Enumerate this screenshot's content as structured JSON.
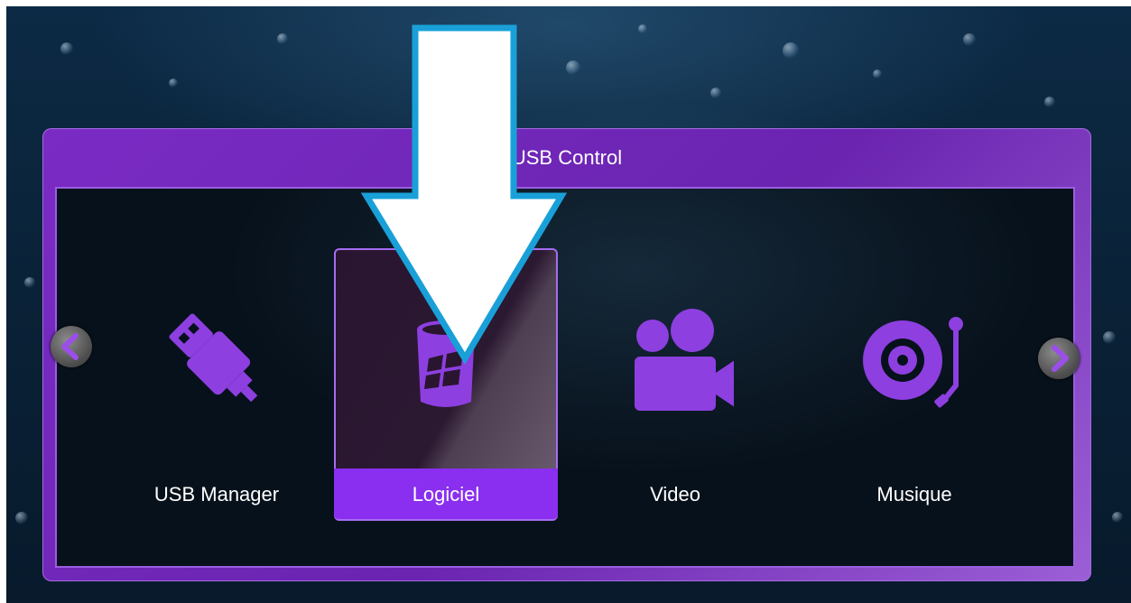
{
  "dialog": {
    "title": "USB Control"
  },
  "menu": {
    "items": [
      {
        "label": "USB Manager",
        "icon": "usb-drive-icon",
        "selected": false
      },
      {
        "label": "Logiciel",
        "icon": "windows-cylinder-icon",
        "selected": true
      },
      {
        "label": "Video",
        "icon": "video-camera-icon",
        "selected": false
      },
      {
        "label": "Musique",
        "icon": "turntable-icon",
        "selected": false
      }
    ]
  },
  "navigation": {
    "left_icon": "chevron-left-icon",
    "right_icon": "chevron-right-icon"
  },
  "colors": {
    "accent": "#8a2ff0",
    "icon": "#8d3fe0",
    "annotation_stroke": "#1aa0d8",
    "annotation_fill": "#ffffff"
  }
}
